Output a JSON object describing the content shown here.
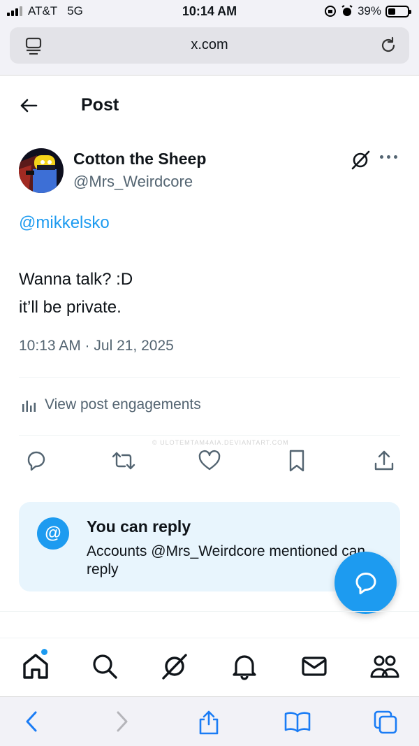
{
  "status_bar": {
    "carrier": "AT&T",
    "network": "5G",
    "time": "10:14 AM",
    "battery_percent_label": "39%",
    "battery_level": 0.39
  },
  "browser": {
    "url": "x.com"
  },
  "header": {
    "title": "Post"
  },
  "post": {
    "author_name": "Cotton the Sheep",
    "author_handle": "@Mrs_Weirdcore",
    "mention": "@mikkelsko",
    "body_line1": "Wanna talk? :D",
    "body_line2": "it’ll be private.",
    "timestamp": "10:13 AM · Jul 21, 2025",
    "engagements_label": "View post engagements"
  },
  "reply_card": {
    "icon_label": "@",
    "title": "You can reply",
    "description": "Accounts @Mrs_Weirdcore mentioned can reply"
  },
  "watermark": "© ULOTEMTAM4AIA.DEVIANTART.COM",
  "colors": {
    "accent": "#1d9bf0",
    "text_primary": "#0f1419",
    "text_secondary": "#536471",
    "reply_card_bg": "#e8f5fd",
    "browser_chrome": "#f2f2f7"
  },
  "icons": {
    "action_bar": [
      "reply-icon",
      "repost-icon",
      "like-icon",
      "bookmark-icon",
      "share-icon"
    ],
    "tab_bar": [
      "home-icon",
      "search-icon",
      "grok-icon",
      "notifications-icon",
      "messages-icon",
      "communities-icon"
    ],
    "safari_toolbar": [
      "back-icon",
      "forward-icon",
      "share-icon",
      "bookmarks-icon",
      "tabs-icon"
    ]
  }
}
